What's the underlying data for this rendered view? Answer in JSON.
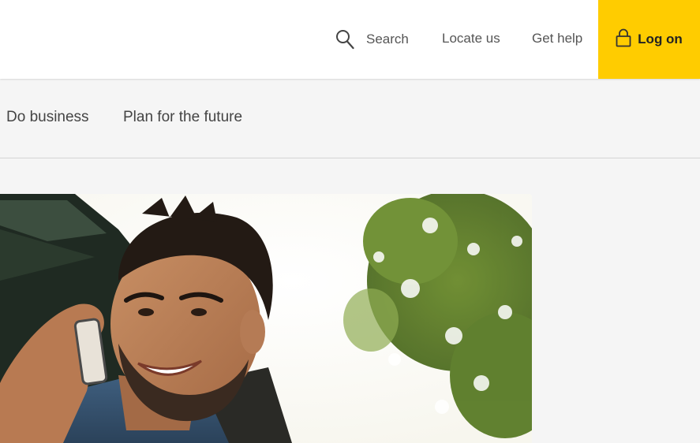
{
  "header": {
    "search_label": "Search",
    "locate_label": "Locate us",
    "help_label": "Get help",
    "logon_label": "Log on",
    "accent_color": "#ffcc00"
  },
  "nav": {
    "items": [
      {
        "label": "Do business"
      },
      {
        "label": "Plan for the future"
      }
    ]
  },
  "hero": {
    "image": "man-on-phone-smiling-photo"
  },
  "icons": {
    "search": "search-icon",
    "logon": "lock-icon"
  }
}
